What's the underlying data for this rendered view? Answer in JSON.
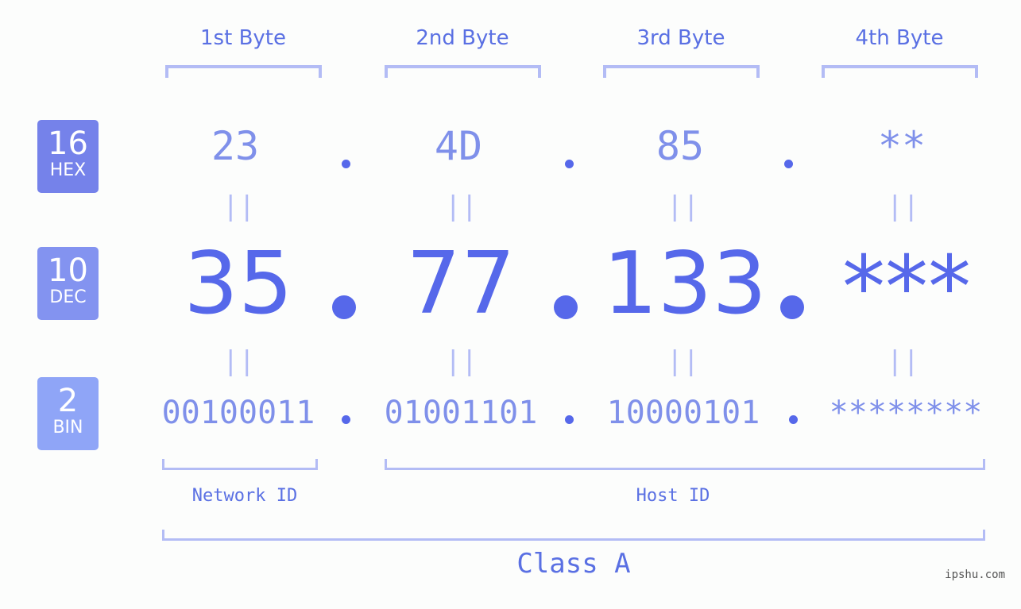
{
  "headers": [
    "1st Byte",
    "2nd Byte",
    "3rd Byte",
    "4th Byte"
  ],
  "badges": {
    "hex": {
      "num": "16",
      "label": "HEX",
      "color": "#7582ea"
    },
    "dec": {
      "num": "10",
      "label": "DEC",
      "color": "#8393f0"
    },
    "bin": {
      "num": "2",
      "label": "BIN",
      "color": "#8fa5f7"
    }
  },
  "hex": [
    "23",
    "4D",
    "85",
    "**"
  ],
  "dec": [
    "35",
    "77",
    "133",
    "***"
  ],
  "bin": [
    "00100011",
    "01001101",
    "10000101",
    "********"
  ],
  "equals_symbol": "||",
  "network_id_label": "Network ID",
  "host_id_label": "Host ID",
  "class_label": "Class A",
  "watermark": "ipshu.com",
  "colors": {
    "accent": "#5668ea",
    "light": "#7f90ea",
    "bracket": "#b3bcf5"
  }
}
